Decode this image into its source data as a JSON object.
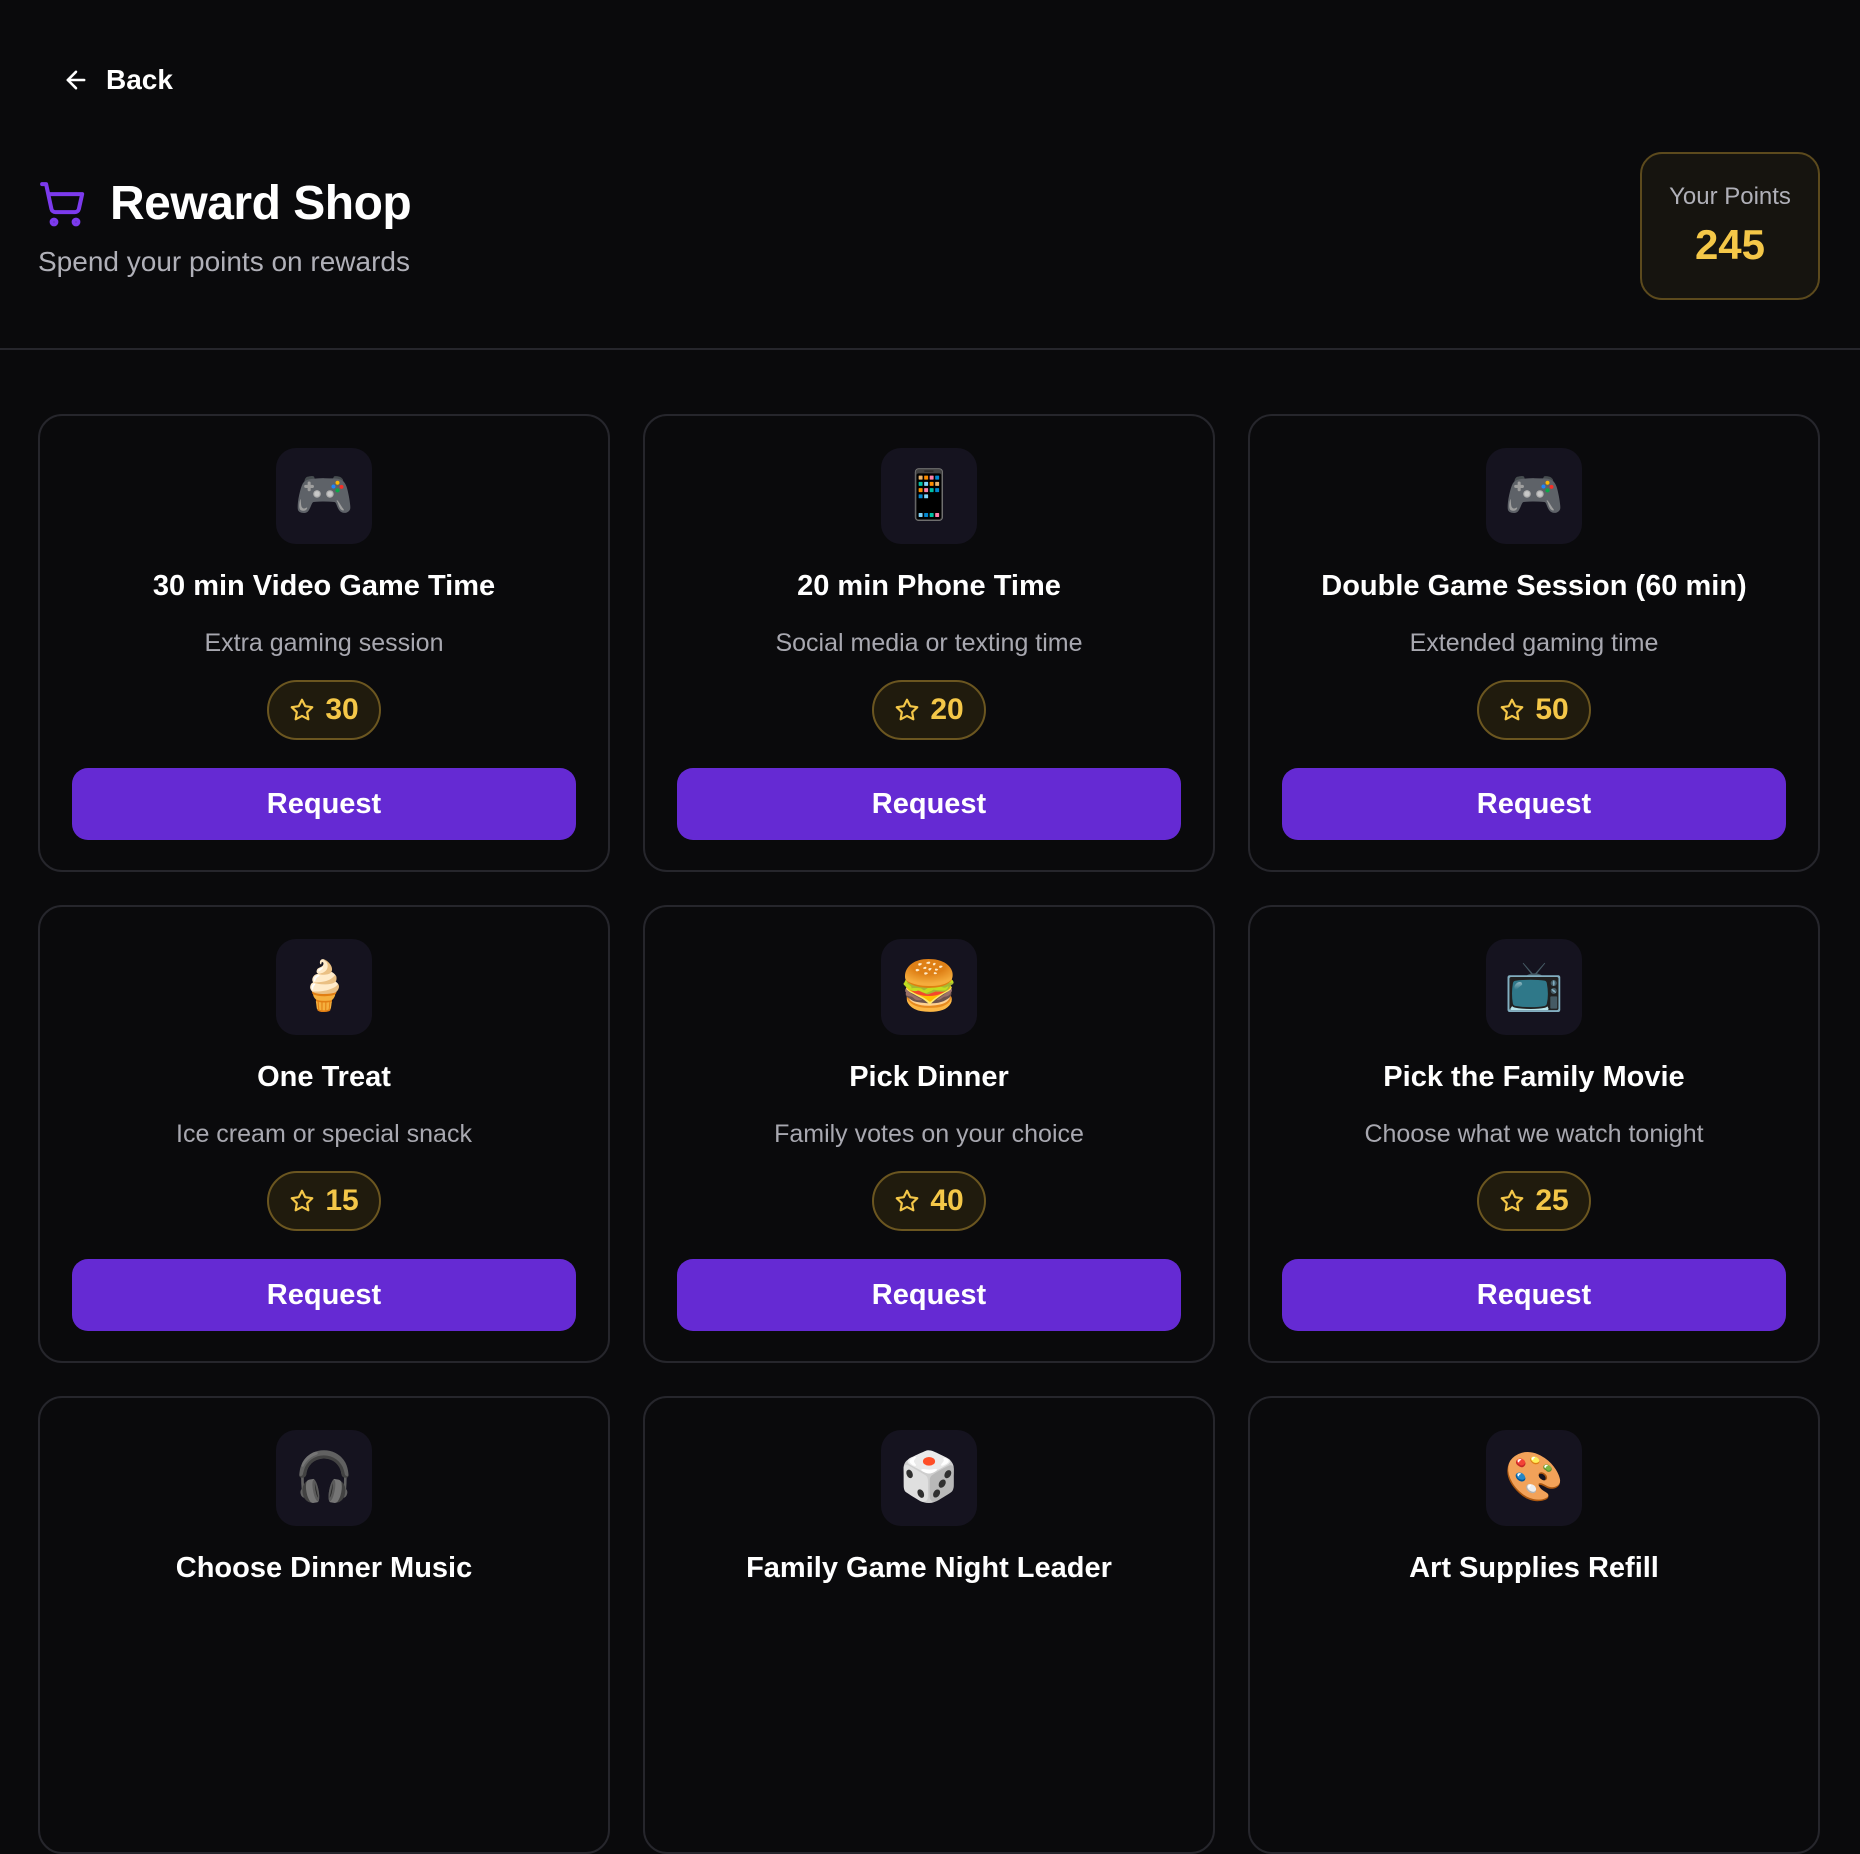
{
  "header": {
    "back_label": "Back",
    "title": "Reward Shop",
    "subtitle": "Spend your points on rewards",
    "points_label": "Your Points",
    "points_value": "245"
  },
  "colors": {
    "accent": "#652ad3",
    "gold": "#f4c748",
    "background": "#0a0a0c"
  },
  "rewards": [
    {
      "icon": "game-controller-icon",
      "glyph": "🎮",
      "title": "30 min Video Game Time",
      "description": "Extra gaming session",
      "cost": "30",
      "button": "Request"
    },
    {
      "icon": "mobile-phone-icon",
      "glyph": "📱",
      "title": "20 min Phone Time",
      "description": "Social media or texting time",
      "cost": "20",
      "button": "Request"
    },
    {
      "icon": "game-controller-icon",
      "glyph": "🎮",
      "title": "Double Game Session (60 min)",
      "description": "Extended gaming time",
      "cost": "50",
      "button": "Request"
    },
    {
      "icon": "ice-cream-icon",
      "glyph": "🍦",
      "title": "One Treat",
      "description": "Ice cream or special snack",
      "cost": "15",
      "button": "Request"
    },
    {
      "icon": "burger-icon",
      "glyph": "🍔",
      "title": "Pick Dinner",
      "description": "Family votes on your choice",
      "cost": "40",
      "button": "Request"
    },
    {
      "icon": "television-icon",
      "glyph": "📺",
      "title": "Pick the Family Movie",
      "description": "Choose what we watch tonight",
      "cost": "25",
      "button": "Request"
    },
    {
      "icon": "headphones-icon",
      "glyph": "🎧",
      "title": "Choose Dinner Music",
      "description": "",
      "cost": "",
      "button": ""
    },
    {
      "icon": "dice-icon",
      "glyph": "🎲",
      "title": "Family Game Night Leader",
      "description": "",
      "cost": "",
      "button": ""
    },
    {
      "icon": "art-palette-icon",
      "glyph": "🎨",
      "title": "Art Supplies Refill",
      "description": "",
      "cost": "",
      "button": ""
    }
  ]
}
